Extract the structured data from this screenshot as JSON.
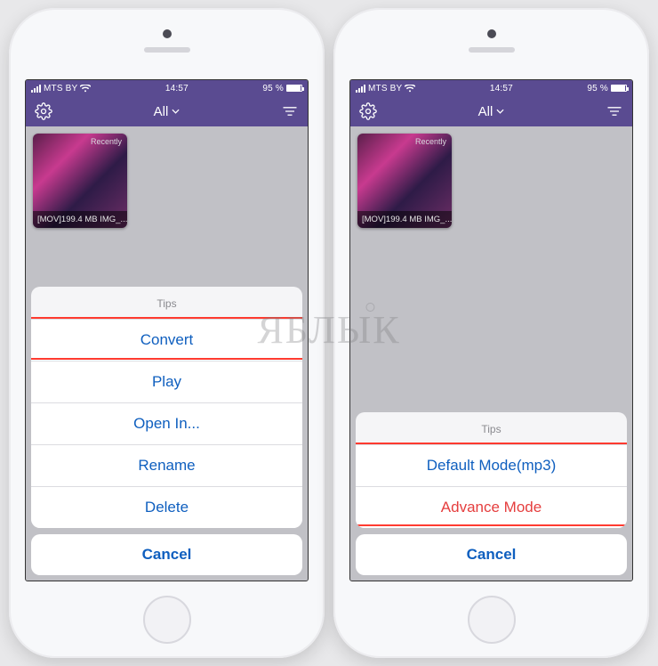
{
  "status": {
    "carrier": "MTS BY",
    "time": "14:57",
    "battery_pct": "95 %"
  },
  "nav": {
    "title": "All"
  },
  "thumbnail": {
    "badge": "Recently",
    "caption": "[MOV]199.4 MB IMG_..."
  },
  "left_sheet": {
    "title": "Tips",
    "items": [
      "Convert",
      "Play",
      "Open In...",
      "Rename",
      "Delete"
    ],
    "cancel": "Cancel"
  },
  "right_sheet": {
    "title": "Tips",
    "items": [
      "Default Mode(mp3)",
      "Advance Mode"
    ],
    "cancel": "Cancel"
  },
  "watermark": "ЯБЛЫК"
}
